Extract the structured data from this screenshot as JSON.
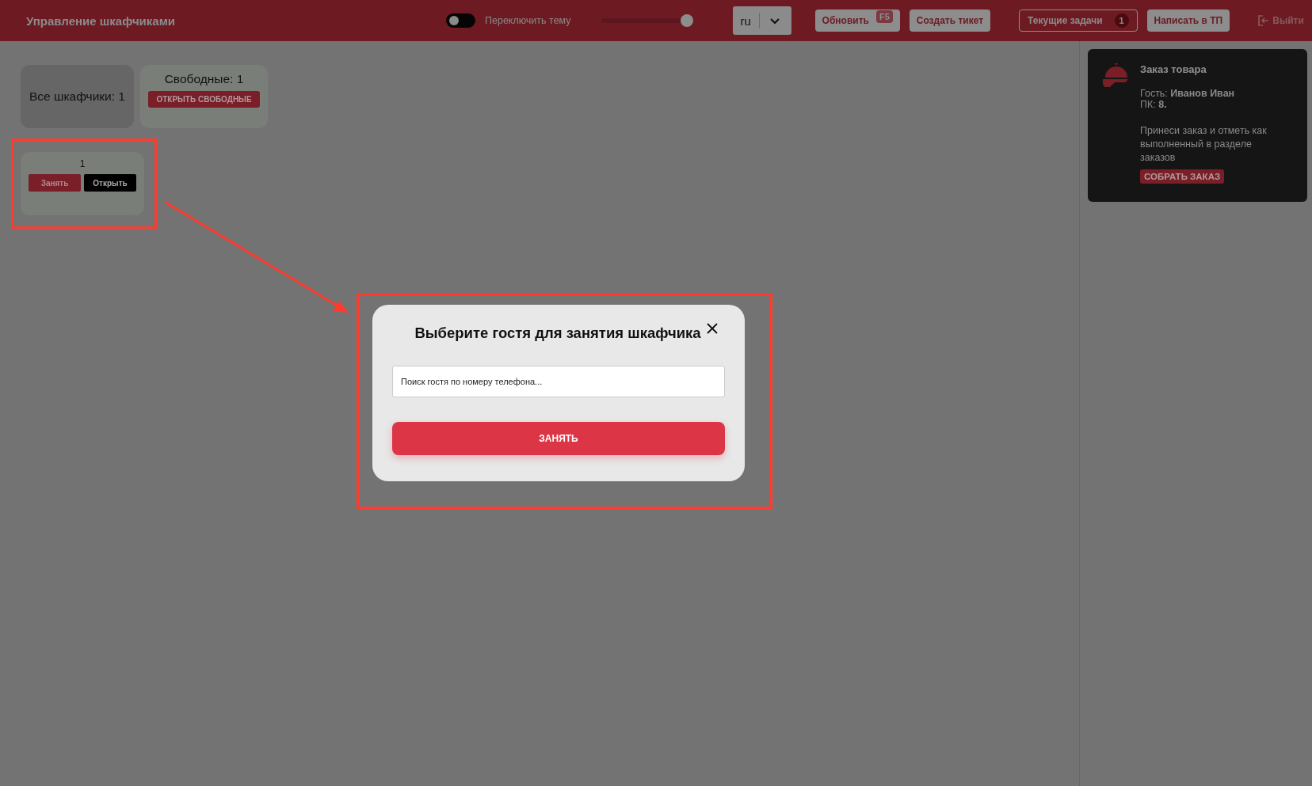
{
  "header": {
    "title": "Управление шкафчиками",
    "theme_toggle": {
      "label": "Переключить тему",
      "on": false
    },
    "slider": {
      "level": 0.95
    },
    "language": {
      "value": "ru"
    },
    "buttons": [
      {
        "label": "Обновить",
        "kind": "shortcut",
        "shortcut": "F5"
      },
      {
        "label": "Создать тикет",
        "kind": "plain"
      },
      {
        "label": "Текущие задачи",
        "kind": "outlined",
        "badge": "1"
      },
      {
        "label": "Написать в ТП",
        "kind": "plain"
      }
    ],
    "logout": {
      "label": "Выйти"
    }
  },
  "summary": [
    {
      "label": "Все шкафчики: 1",
      "selected": true
    },
    {
      "label": "Свободные: 1",
      "selected": false,
      "button": "ОТКРЫТЬ СВОБОДНЫЕ"
    }
  ],
  "lockers": [
    {
      "number": "1",
      "buttons": [
        "Занять",
        "Открыть"
      ]
    }
  ],
  "notifications": [
    {
      "title": "Заказ товара",
      "guest": "Гость: **Иванов Иван**",
      "pc": "ПК: **8.**",
      "message": "Принеси заказ и отметь как выполненный в разделе заказов",
      "action": "СОБРАТЬ ЗАКАЗ"
    }
  ],
  "modal": {
    "title": "Выберите гостя для занятия шкафчика",
    "search": {
      "placeholder": "Поиск гостя по номеру телефона..."
    },
    "submit": "ЗАНЯТЬ"
  }
}
